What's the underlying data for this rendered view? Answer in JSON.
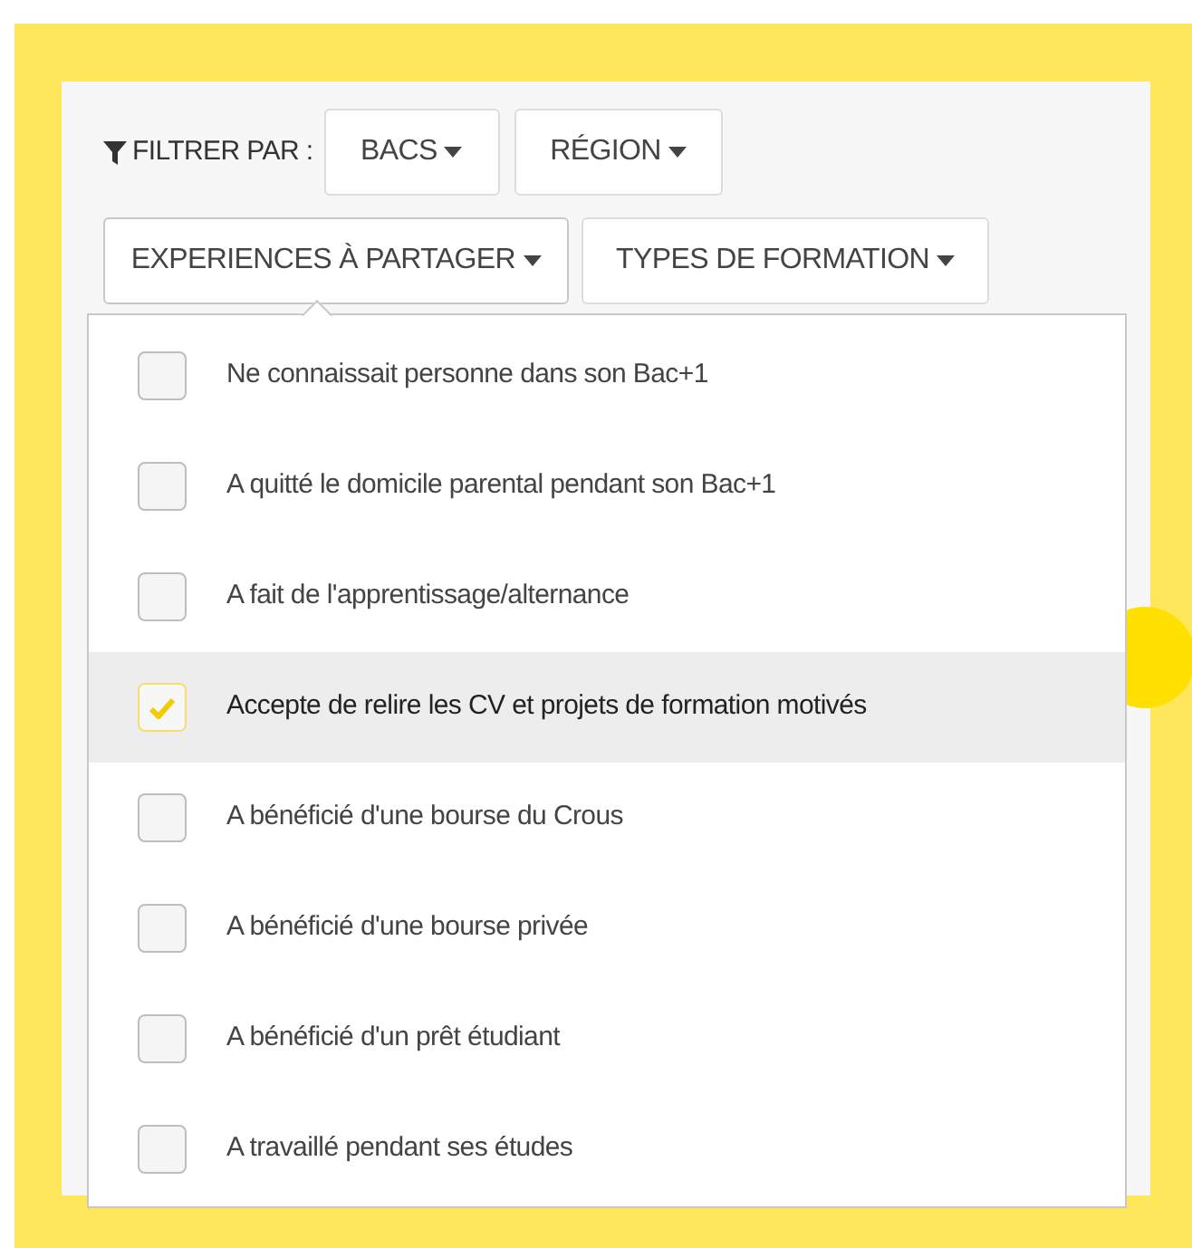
{
  "filter_label": "FILTRER PAR :",
  "filters": [
    {
      "label": "BACS",
      "expanded": false
    },
    {
      "label": "RÉGION",
      "expanded": false
    },
    {
      "label": "EXPERIENCES À PARTAGER",
      "expanded": true
    },
    {
      "label": "TYPES DE FORMATION",
      "expanded": false
    }
  ],
  "options": [
    {
      "label": "Ne connaissait personne dans son Bac+1",
      "checked": false,
      "selected": false
    },
    {
      "label": "A quitté le domicile parental pendant son Bac+1",
      "checked": false,
      "selected": false
    },
    {
      "label": "A fait de l'apprentissage/alternance",
      "checked": false,
      "selected": false
    },
    {
      "label": "Accepte de relire les CV et projets de formation motivés",
      "checked": true,
      "selected": true
    },
    {
      "label": "A bénéficié d'une bourse du Crous",
      "checked": false,
      "selected": false
    },
    {
      "label": "A bénéficié d'une bourse privée",
      "checked": false,
      "selected": false
    },
    {
      "label": "A bénéficié d'un prêt étudiant",
      "checked": false,
      "selected": false
    },
    {
      "label": "A travaillé pendant ses études",
      "checked": false,
      "selected": false
    }
  ]
}
